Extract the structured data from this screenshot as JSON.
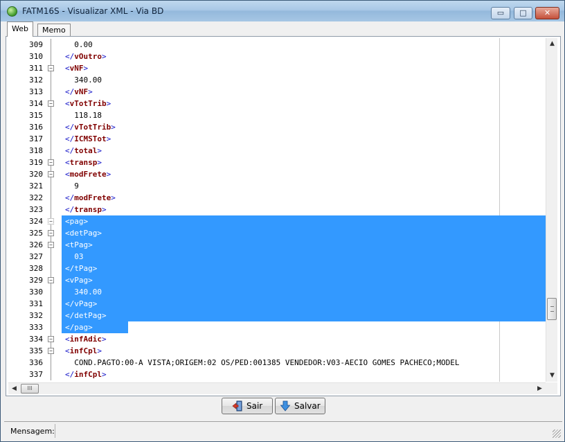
{
  "window": {
    "title": "FATM16S - Visualizar XML - Via BD",
    "minimize_label": "▭",
    "maximize_label": "□",
    "close_label": "✕"
  },
  "tabs": [
    {
      "label": "Web",
      "active": true
    },
    {
      "label": "Memo",
      "active": false
    }
  ],
  "editor": {
    "lines": [
      {
        "n": "309",
        "text": "0.00",
        "kind": "text",
        "indent": 2,
        "fold": "line",
        "selected": false
      },
      {
        "n": "310",
        "text": "vOutro",
        "kind": "close",
        "indent": 1,
        "fold": "line",
        "selected": false
      },
      {
        "n": "311",
        "text": "vNF",
        "kind": "open",
        "indent": 1,
        "fold": "box",
        "selected": false
      },
      {
        "n": "312",
        "text": "340.00",
        "kind": "text",
        "indent": 2,
        "fold": "line",
        "selected": false
      },
      {
        "n": "313",
        "text": "vNF",
        "kind": "close",
        "indent": 1,
        "fold": "line",
        "selected": false
      },
      {
        "n": "314",
        "text": "vTotTrib",
        "kind": "open",
        "indent": 1,
        "fold": "box",
        "selected": false
      },
      {
        "n": "315",
        "text": "118.18",
        "kind": "text",
        "indent": 2,
        "fold": "line",
        "selected": false
      },
      {
        "n": "316",
        "text": "vTotTrib",
        "kind": "close",
        "indent": 1,
        "fold": "line",
        "selected": false
      },
      {
        "n": "317",
        "text": "ICMSTot",
        "kind": "close",
        "indent": 1,
        "fold": "line",
        "selected": false
      },
      {
        "n": "318",
        "text": "total",
        "kind": "close",
        "indent": 1,
        "fold": "line",
        "selected": false
      },
      {
        "n": "319",
        "text": "transp",
        "kind": "open",
        "indent": 1,
        "fold": "box",
        "selected": false
      },
      {
        "n": "320",
        "text": "modFrete",
        "kind": "open",
        "indent": 1,
        "fold": "box",
        "selected": false
      },
      {
        "n": "321",
        "text": "9",
        "kind": "text",
        "indent": 2,
        "fold": "line",
        "selected": false
      },
      {
        "n": "322",
        "text": "modFrete",
        "kind": "close",
        "indent": 1,
        "fold": "line",
        "selected": false
      },
      {
        "n": "323",
        "text": "transp",
        "kind": "close",
        "indent": 1,
        "fold": "line",
        "selected": false
      },
      {
        "n": "324",
        "text": "pag",
        "kind": "open",
        "indent": 1,
        "fold": "box-dotted",
        "selected": true
      },
      {
        "n": "325",
        "text": "detPag",
        "kind": "open",
        "indent": 1,
        "fold": "box",
        "selected": true
      },
      {
        "n": "326",
        "text": "tPag",
        "kind": "open",
        "indent": 1,
        "fold": "box",
        "selected": true
      },
      {
        "n": "327",
        "text": "03",
        "kind": "text",
        "indent": 2,
        "fold": "line",
        "selected": true
      },
      {
        "n": "328",
        "text": "tPag",
        "kind": "close",
        "indent": 1,
        "fold": "line",
        "selected": true
      },
      {
        "n": "329",
        "text": "vPag",
        "kind": "open",
        "indent": 1,
        "fold": "box",
        "selected": true
      },
      {
        "n": "330",
        "text": "340.00",
        "kind": "text",
        "indent": 2,
        "fold": "line",
        "selected": true
      },
      {
        "n": "331",
        "text": "vPag",
        "kind": "close",
        "indent": 1,
        "fold": "line",
        "selected": true
      },
      {
        "n": "332",
        "text": "detPag",
        "kind": "close",
        "indent": 1,
        "fold": "line",
        "selected": true
      },
      {
        "n": "333",
        "text": "pag",
        "kind": "close",
        "indent": 1,
        "fold": "line",
        "selected": "partial"
      },
      {
        "n": "334",
        "text": "infAdic",
        "kind": "open",
        "indent": 1,
        "fold": "box",
        "selected": false
      },
      {
        "n": "335",
        "text": "infCpl",
        "kind": "open",
        "indent": 1,
        "fold": "box",
        "selected": false
      },
      {
        "n": "336",
        "text": "COND.PAGTO:00-A VISTA;ORIGEM:02 OS/PED:001385 VENDEDOR:V03-AECIO GOMES PACHECO;MODEL",
        "kind": "text",
        "indent": 2,
        "fold": "line",
        "selected": false
      },
      {
        "n": "337",
        "text": "infCpl",
        "kind": "close",
        "indent": 1,
        "fold": "line",
        "selected": false
      }
    ],
    "scroll": {
      "vertical_position": 0.8
    }
  },
  "scrollbars": {
    "up_arrow": "▲",
    "down_arrow": "▼",
    "left_arrow": "◀",
    "right_arrow": "▶",
    "thumb_grip": "III"
  },
  "buttons": {
    "sair_label": "Sair",
    "salvar_label": "Salvar"
  },
  "status": {
    "message_label": "Mensagem:"
  },
  "colors": {
    "selection": "#3399ff",
    "tag_name": "#800000",
    "bracket": "#1414c8"
  }
}
